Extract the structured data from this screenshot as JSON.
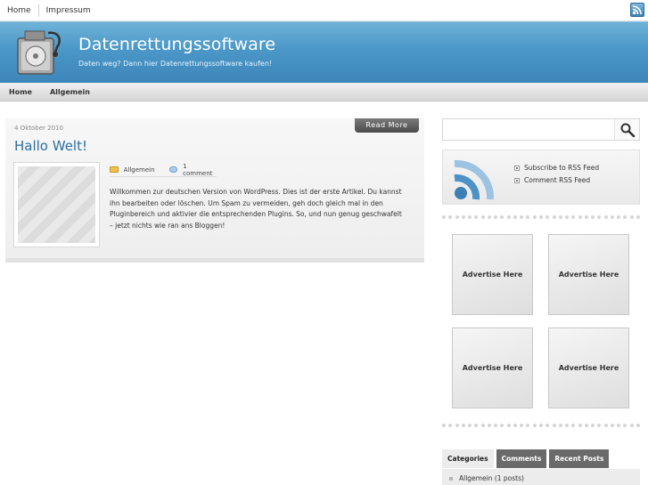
{
  "top_nav": {
    "home": "Home",
    "impressum": "Impressum"
  },
  "header": {
    "title": "Datenrettungssoftware",
    "tagline": "Daten weg? Dann hier Datenrettungssoftware kaufen!"
  },
  "main_nav": {
    "home": "Home",
    "allgemein": "Allgemein"
  },
  "post": {
    "date": "4 Oktober 2010",
    "read_more": "Read More",
    "title": "Hallo Welt!",
    "category": "Allgemein",
    "comments": "1 comment",
    "body": "Willkommen zur deutschen Version von WordPress. Dies ist der erste Artikel. Du kannst ihn bearbeiten oder löschen. Um Spam zu vermeiden, geh doch gleich mal in den Pluginbereich und aktivier die entsprechenden Plugins. So, und nun genug geschwafelt – jetzt nichts wie ran ans Bloggen!"
  },
  "sidebar": {
    "search": {
      "value": "",
      "placeholder": ""
    },
    "rss": {
      "subscribe": "Subscribe to RSS Feed",
      "comment": "Comment RSS Feed"
    },
    "ads": [
      "Advertise Here",
      "Advertise Here",
      "Advertise Here",
      "Advertise Here"
    ],
    "tabs": [
      "Categories",
      "Comments",
      "Recent Posts"
    ],
    "categories": [
      {
        "label": "Allgemein  (1 posts)"
      }
    ]
  },
  "colors": {
    "header_blue": "#4a97c8",
    "link_blue": "#2c6fa3",
    "tab_dark": "#6a6a6a"
  },
  "icons": [
    "rss-icon",
    "disk-utility-logo-icon",
    "folder-icon",
    "comment-bubble-icon",
    "magnifier-icon"
  ]
}
